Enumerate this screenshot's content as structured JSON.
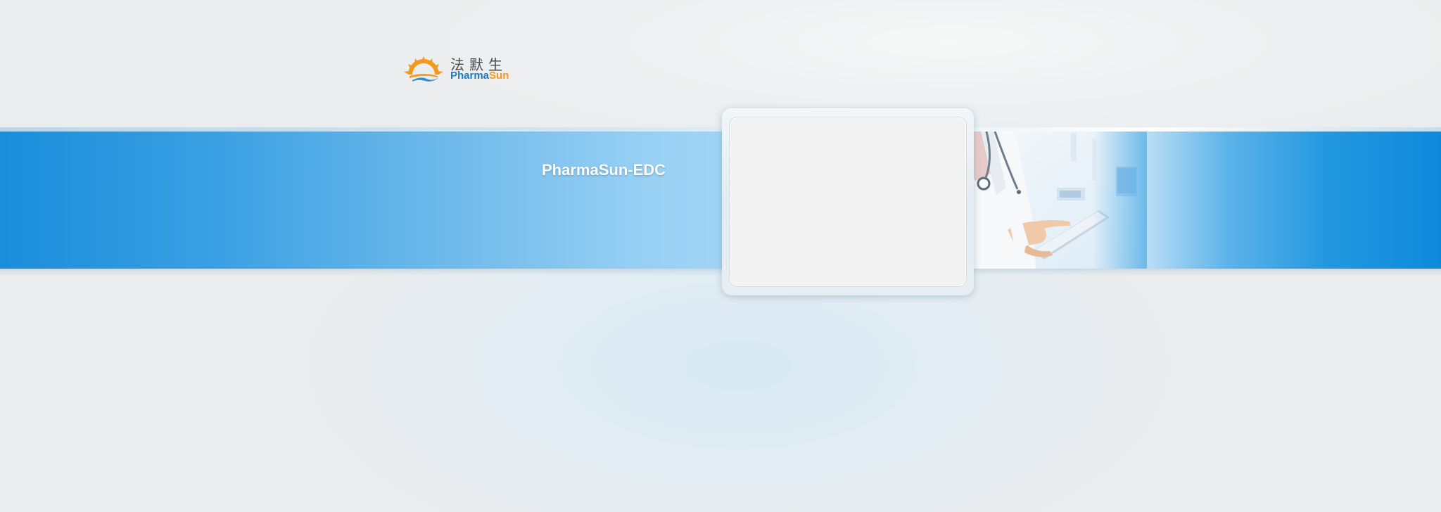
{
  "logo": {
    "icon": "sun-logo-icon",
    "chinese_name": "法默生",
    "brand_part1": "Pharma",
    "brand_part2": "Sun",
    "colors": {
      "sun": "#f39a1e",
      "wave": "#2f8fd0",
      "brand_blue": "#1c7cc2",
      "brand_orange": "#f39a1e"
    }
  },
  "banner": {
    "title": "PharmaSun-EDC",
    "image": "doctor-with-tablet-photo",
    "colors": {
      "band_dark": "#0e89dc",
      "band_light": "#a4d6f6"
    }
  },
  "login_panel": {
    "icon": "login-box"
  }
}
